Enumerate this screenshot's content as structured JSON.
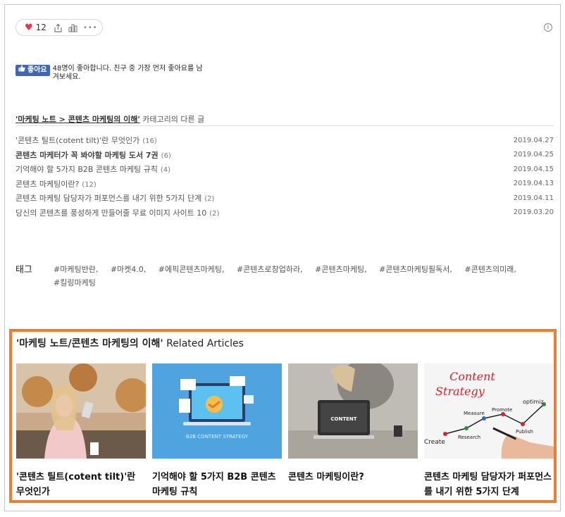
{
  "reactions": {
    "like_count": "12"
  },
  "fb": {
    "button_label": "좋아요",
    "text": "48명이 좋아합니다. 친구 중 가장 먼저 좋아요를 남겨보세요."
  },
  "category": {
    "path": "'마케팅 노트 > 콘텐츠 마케팅의 이해'",
    "suffix": " 카테고리의 다른 글",
    "items": [
      {
        "title": "'콘텐츠 틸트(cotent tilt)'란 무엇인가",
        "count": "(16)",
        "date": "2019.04.27",
        "bold": false
      },
      {
        "title": "콘텐츠 마케터가 꼭 봐야할 마케팅 도서 7권",
        "count": "(6)",
        "date": "2019.04.25",
        "bold": true
      },
      {
        "title": "기억해야 할 5가지 B2B 콘텐츠 마케팅 규칙",
        "count": "(4)",
        "date": "2019.04.15",
        "bold": false
      },
      {
        "title": "콘텐츠 마케팅이란?",
        "count": "(12)",
        "date": "2019.04.13",
        "bold": false
      },
      {
        "title": "콘텐츠 마케팅 담당자가 퍼포먼스를 내기 위한 5가지 단계",
        "count": "(2)",
        "date": "2019.04.11",
        "bold": false
      },
      {
        "title": "당신의 콘텐츠를 풍성하게 만들어줄 무료 이미지 사이트 10",
        "count": "(2)",
        "date": "2019.03.20",
        "bold": false
      }
    ]
  },
  "tags": {
    "label": "태그",
    "items": [
      "#마케팅반란,",
      "#마켓4.0,",
      "#에픽콘텐츠마케팅,",
      "#콘텐츠로창업하라,",
      "#콘텐츠마케팅,",
      "#콘텐츠마케팅필독서,",
      "#콘텐츠의미래,",
      "#킬링마케팅"
    ]
  },
  "related": {
    "title_bold": "'마케팅 노트/콘텐츠 마케팅의 이해'",
    "title_suffix": " Related Articles",
    "cards": [
      {
        "caption": "'콘텐츠 틸트(cotent tilt)'란 무엇인가"
      },
      {
        "caption": "기억해야 할 5가지 B2B 콘텐츠 마케팅 규칙",
        "image_text": "B2B CONTENT STRATEGY"
      },
      {
        "caption": "콘텐츠 마케팅이란?",
        "image_text": "CONTENT"
      },
      {
        "caption": "콘텐츠 마케팅 담당자가 퍼포먼스를 내기 위한 5가지 단계",
        "image_text": [
          "Content",
          "Strategy",
          "Measure",
          "Promote",
          "optimiz",
          "Publish",
          "Research",
          "Create"
        ]
      }
    ]
  }
}
